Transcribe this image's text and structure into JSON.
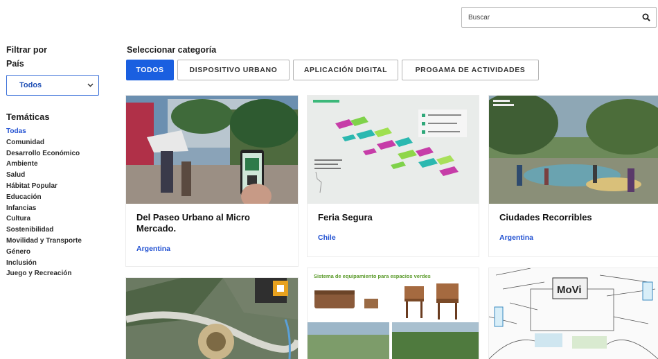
{
  "search": {
    "placeholder": "Buscar",
    "icon": "search-icon"
  },
  "sidebar": {
    "filter_title": "Filtrar por",
    "country_label": "País",
    "country_selected": "Todos",
    "tematicas_title": "Temáticas",
    "tematicas": [
      "Todas",
      "Comunidad",
      "Desarrollo Económico",
      "Ambiente",
      "Salud",
      "Hábitat Popular",
      "Educación",
      "Infancias",
      "Cultura",
      "Sostenibilidad",
      "Movilidad y Transporte",
      "Género",
      "Inclusión",
      "Juego y Recreación"
    ],
    "active_tematica": "Todas"
  },
  "category": {
    "title": "Seleccionar categoría",
    "tabs": [
      "TODOS",
      "DISPOSITIVO URBANO",
      "APLICACIÓN DIGITAL",
      "PROGAMA DE ACTIVIDADES"
    ],
    "active": "TODOS"
  },
  "cards": [
    {
      "title": "Del Paseo Urbano al Micro Mercado.",
      "country": "Argentina"
    },
    {
      "title": "Feria Segura",
      "country": "Chile"
    },
    {
      "title": "Ciudades Recorribles",
      "country": "Argentina"
    },
    {
      "title": "",
      "country": "",
      "image_text": ""
    },
    {
      "title": "",
      "country": "",
      "image_text": "Sistema de equipamiento para espacios verdes"
    },
    {
      "title": "",
      "country": "",
      "image_text": "MoVi"
    }
  ],
  "colors": {
    "accent": "#1a5fe0",
    "link": "#1f4fd1"
  }
}
